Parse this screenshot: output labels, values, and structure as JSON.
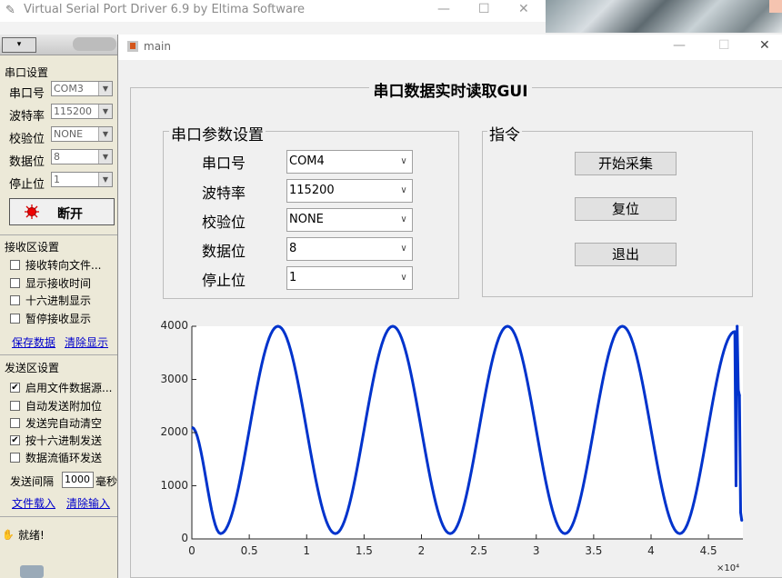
{
  "vspd": {
    "title": "Virtual Serial Port Driver 6.9 by Eltima Software",
    "minimize": "—",
    "restore": "☐",
    "close": "✕"
  },
  "left": {
    "serial_section": "串口设置",
    "fields": [
      {
        "label": "串口号",
        "value": "COM3"
      },
      {
        "label": "波特率",
        "value": "115200"
      },
      {
        "label": "校验位",
        "value": "NONE"
      },
      {
        "label": "数据位",
        "value": "8"
      },
      {
        "label": "停止位",
        "value": "1"
      }
    ],
    "disconnect_label": "断开",
    "receive_section": "接收区设置",
    "receive_options": [
      {
        "label": "接收转向文件...",
        "checked": false
      },
      {
        "label": "显示接收时间",
        "checked": false
      },
      {
        "label": "十六进制显示",
        "checked": false
      },
      {
        "label": "暂停接收显示",
        "checked": false
      }
    ],
    "save_data": "保存数据",
    "clear_display": "清除显示",
    "send_section": "发送区设置",
    "send_options": [
      {
        "label": "启用文件数据源...",
        "checked": true
      },
      {
        "label": "自动发送附加位",
        "checked": false
      },
      {
        "label": "发送完自动清空",
        "checked": false
      },
      {
        "label": "按十六进制发送",
        "checked": true
      },
      {
        "label": "数据流循环发送",
        "checked": false
      }
    ],
    "interval_label": "发送间隔",
    "interval_value": "1000",
    "interval_unit": "毫秒",
    "file_load": "文件载入",
    "clear_input": "清除输入",
    "status": "就绪!"
  },
  "main": {
    "window_title": "main",
    "gui_title": "串口数据实时读取GUI",
    "params_title": "串口参数设置",
    "params": [
      {
        "label": "串口号",
        "value": "COM4"
      },
      {
        "label": "波特率",
        "value": "115200"
      },
      {
        "label": "校验位",
        "value": "NONE"
      },
      {
        "label": "数据位",
        "value": "8"
      },
      {
        "label": "停止位",
        "value": "1"
      }
    ],
    "commands_title": "指令",
    "buttons": {
      "start": "开始采集",
      "reset": "复位",
      "exit": "退出"
    }
  },
  "chart_data": {
    "type": "line",
    "xlim": [
      0,
      48000
    ],
    "ylim": [
      0,
      4000
    ],
    "x_ticks": [
      "0",
      "0.5",
      "1",
      "1.5",
      "2",
      "2.5",
      "3",
      "3.5",
      "4",
      "4.5"
    ],
    "y_ticks": [
      "0",
      "1000",
      "2000",
      "3000",
      "4000"
    ],
    "x_exponent_label": "×10⁴",
    "series": [
      {
        "color": "#0033cc",
        "points": [
          [
            0,
            2100
          ],
          [
            2500,
            100
          ],
          [
            7500,
            4000
          ],
          [
            12500,
            100
          ],
          [
            17500,
            4000
          ],
          [
            22500,
            100
          ],
          [
            27500,
            4000
          ],
          [
            32500,
            100
          ],
          [
            37500,
            4000
          ],
          [
            42500,
            100
          ],
          [
            47300,
            3900
          ],
          [
            47400,
            1000
          ],
          [
            47500,
            4000
          ],
          [
            47600,
            2800
          ],
          [
            47700,
            2700
          ],
          [
            47800,
            500
          ],
          [
            47900,
            350
          ]
        ]
      }
    ],
    "grid": false
  }
}
